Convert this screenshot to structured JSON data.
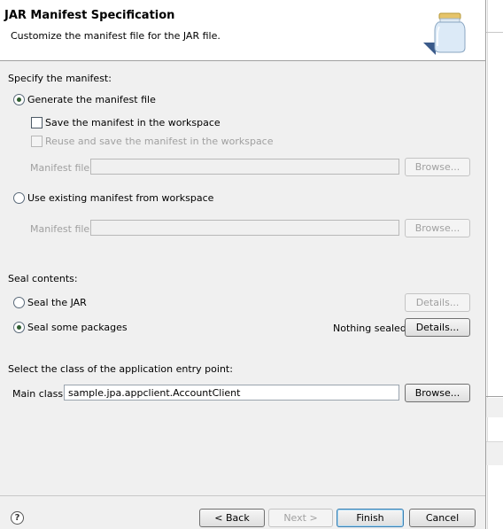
{
  "header": {
    "title": "JAR Manifest Specification",
    "description": "Customize the manifest file for the JAR file."
  },
  "manifest": {
    "section_label": "Specify the manifest:",
    "generate_label": "Generate the manifest file",
    "generate_selected": true,
    "save_label": "Save the manifest in the workspace",
    "save_checked": false,
    "reuse_label": "Reuse and save the manifest in the workspace",
    "reuse_checked": false,
    "file_label_1": "Manifest file:",
    "file_value_1": "",
    "browse_1": "Browse...",
    "use_existing_label": "Use existing manifest from workspace",
    "use_existing_selected": false,
    "file_label_2": "Manifest file:",
    "file_value_2": "",
    "browse_2": "Browse..."
  },
  "seal": {
    "section_label": "Seal contents:",
    "seal_jar_label": "Seal the JAR",
    "seal_jar_selected": false,
    "details_1": "Details...",
    "seal_some_label": "Seal some packages",
    "seal_some_selected": true,
    "status": "Nothing sealed",
    "details_2": "Details..."
  },
  "entry_point": {
    "section_label": "Select the class of the application entry point:",
    "main_class_label": "Main class:",
    "main_class_value": "sample.jpa.appclient.AccountClient",
    "browse": "Browse..."
  },
  "footer": {
    "help_symbol": "?",
    "back": "< Back",
    "next": "Next >",
    "finish": "Finish",
    "cancel": "Cancel"
  }
}
